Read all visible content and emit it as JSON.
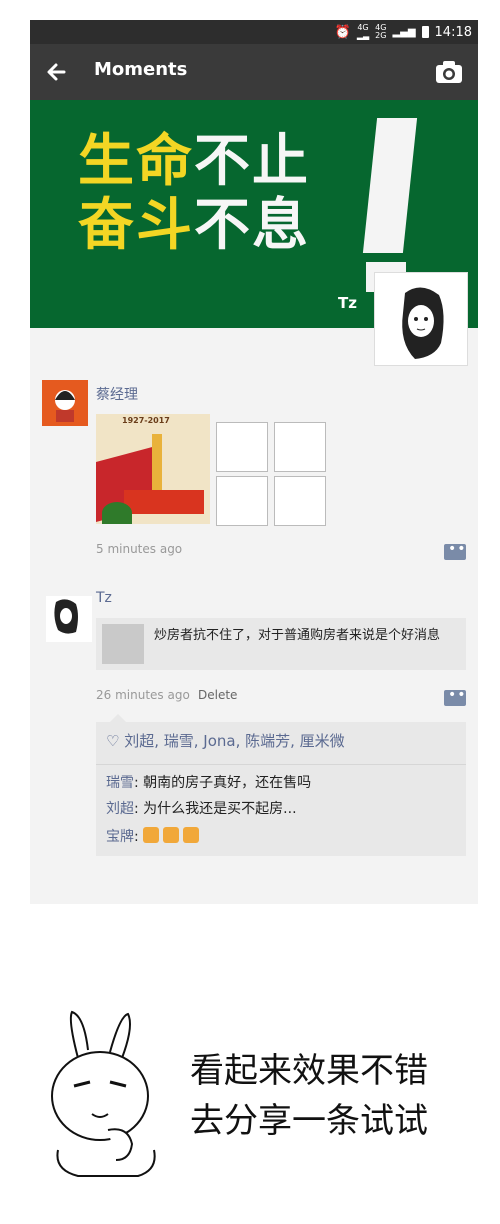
{
  "status": {
    "net1": "4G",
    "net2": "4G",
    "net2b": "2G",
    "time": "14:18"
  },
  "header": {
    "title": "Moments"
  },
  "cover": {
    "line1_a": "生命",
    "line1_b": "不止",
    "line2_a": "奋斗",
    "line2_b": "不息",
    "owner_name": "Tz"
  },
  "posts": [
    {
      "author": "蔡经理",
      "image_caption": "1927-2017",
      "time": "5 minutes ago"
    },
    {
      "author": "Tz",
      "link_text": "炒房者抗不住了，对于普通购房者来说是个好消息",
      "time": "26 minutes ago",
      "delete_label": "Delete",
      "likes": "刘超, 瑞雪, Jona, 陈端芳, 厘米微",
      "comments": [
        {
          "who": "瑞雪",
          "text": ": 朝南的房子真好，还在售吗"
        },
        {
          "who": "刘超",
          "text": ": 为什么我还是买不起房..."
        },
        {
          "who": "宝牌",
          "text": ": "
        }
      ]
    }
  ],
  "caption": {
    "line1": "看起来效果不错",
    "line2": "去分享一条试试"
  },
  "colors": {
    "cover_green": "#06672f",
    "accent_blue": "#5b6a91",
    "yellow": "#f3d624"
  }
}
